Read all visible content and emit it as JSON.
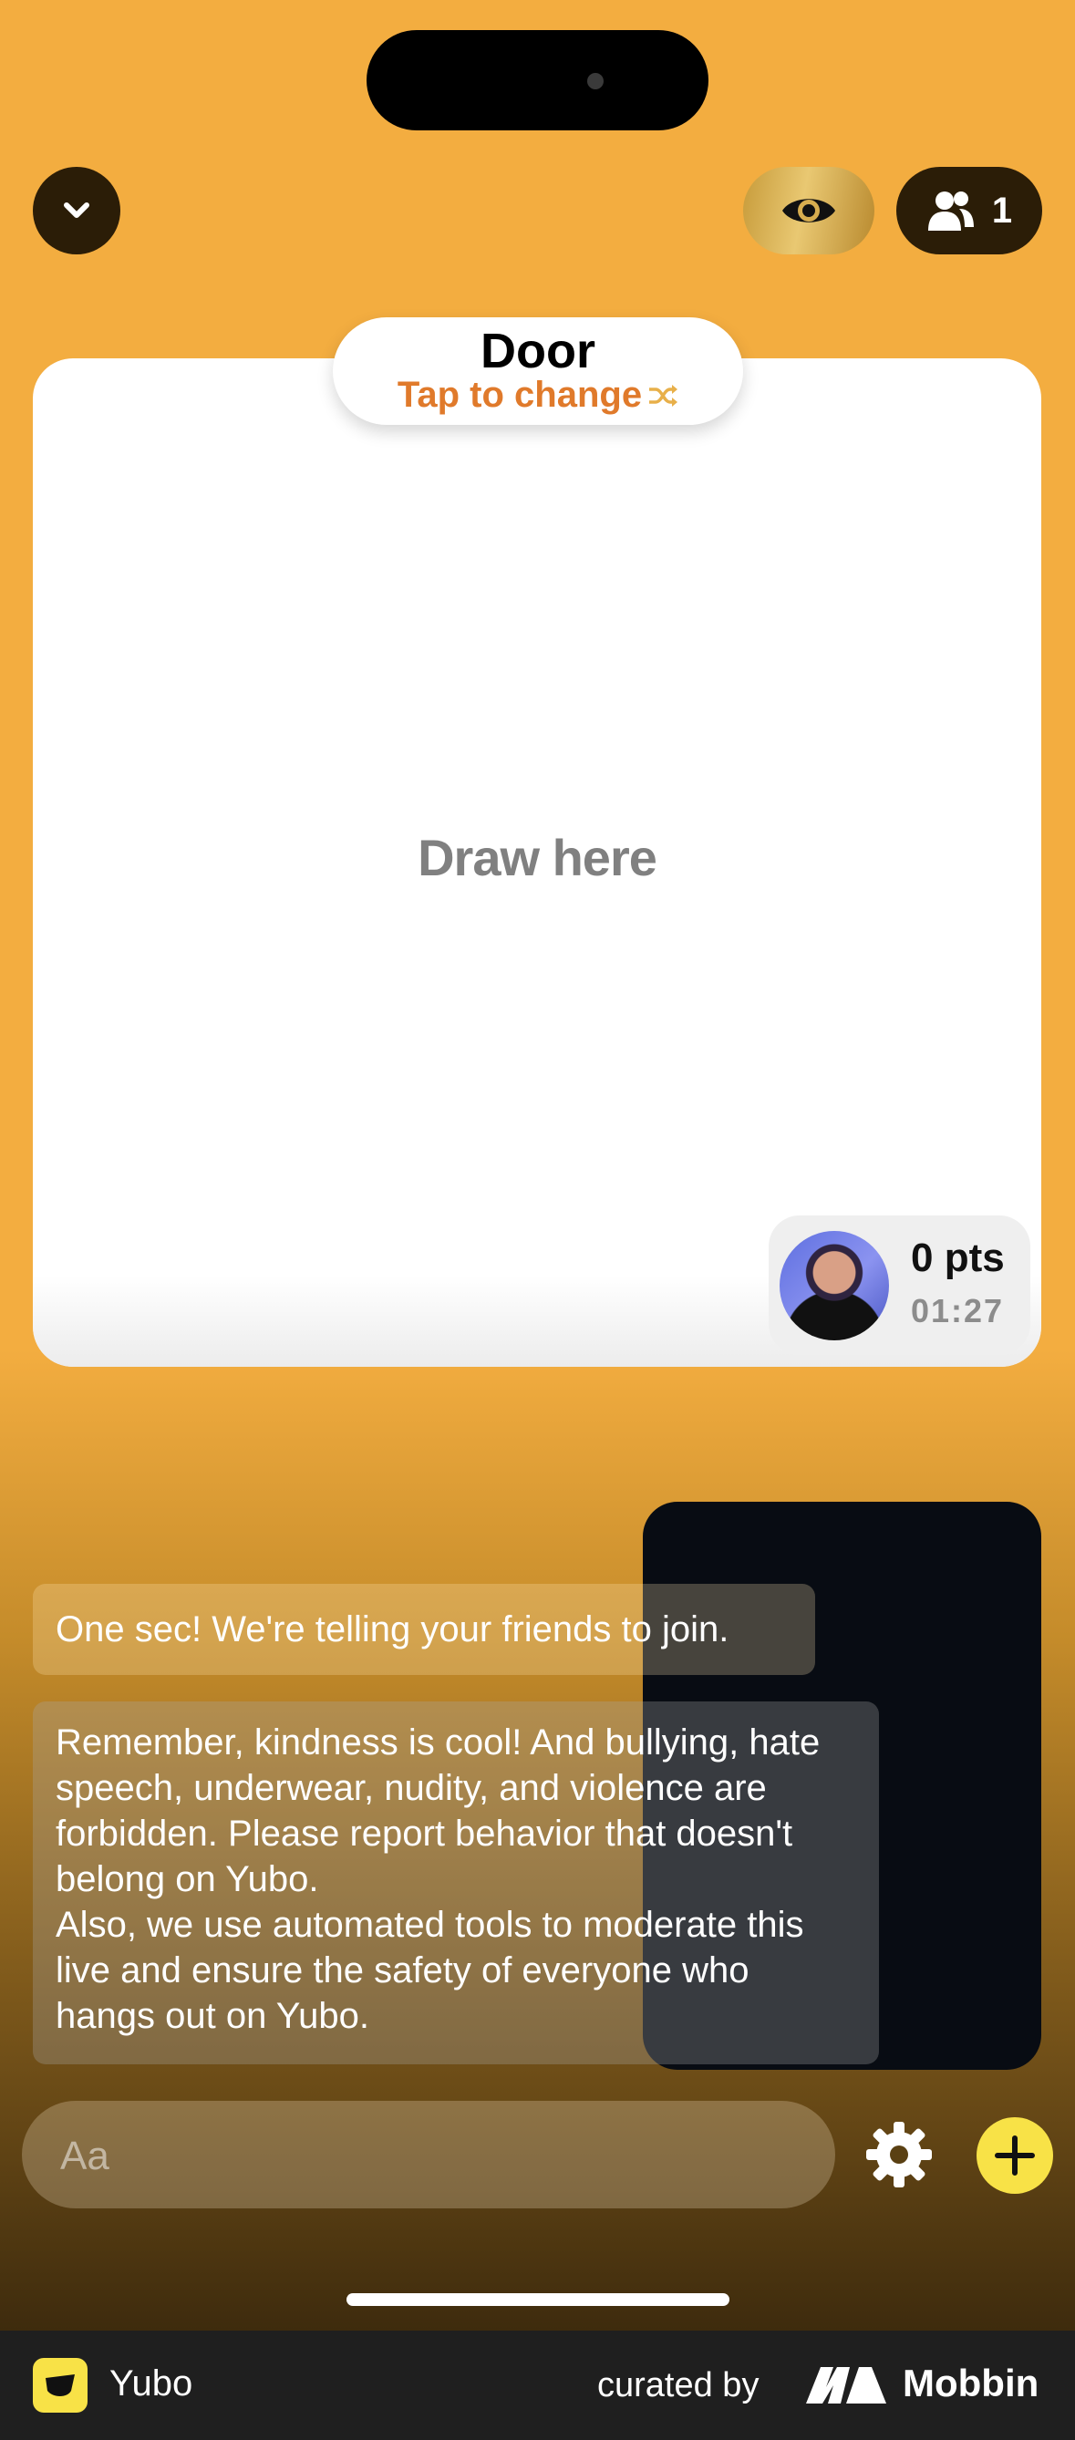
{
  "header": {
    "collapse_icon": "chevron-down-icon",
    "viewer_icon": "eye-icon",
    "participants_icon": "people-icon",
    "participants_count": "1"
  },
  "game": {
    "word": "Door",
    "change_label": "Tap to change",
    "change_icon": "shuffle-icon",
    "canvas_hint": "Draw here"
  },
  "player": {
    "points": "0 pts",
    "timer": "01:27"
  },
  "chat": {
    "messages": [
      "One sec! We're telling your friends to join.",
      "Remember, kindness is cool! And bullying, hate speech, underwear, nudity, and violence are forbidden. Please report behavior that doesn't belong on Yubo.\nAlso, we use automated tools to moderate this live and ensure the safety of everyone who hangs out on Yubo."
    ]
  },
  "composer": {
    "placeholder": "Aa",
    "settings_icon": "gear-icon",
    "add_icon": "plus-icon"
  },
  "footer": {
    "app_name": "Yubo",
    "curated_by": "curated by",
    "brand": "Mobbin"
  },
  "colors": {
    "background": "#f3ad40",
    "accent_orange": "#e07a2b",
    "plus_yellow": "#f8e247"
  }
}
